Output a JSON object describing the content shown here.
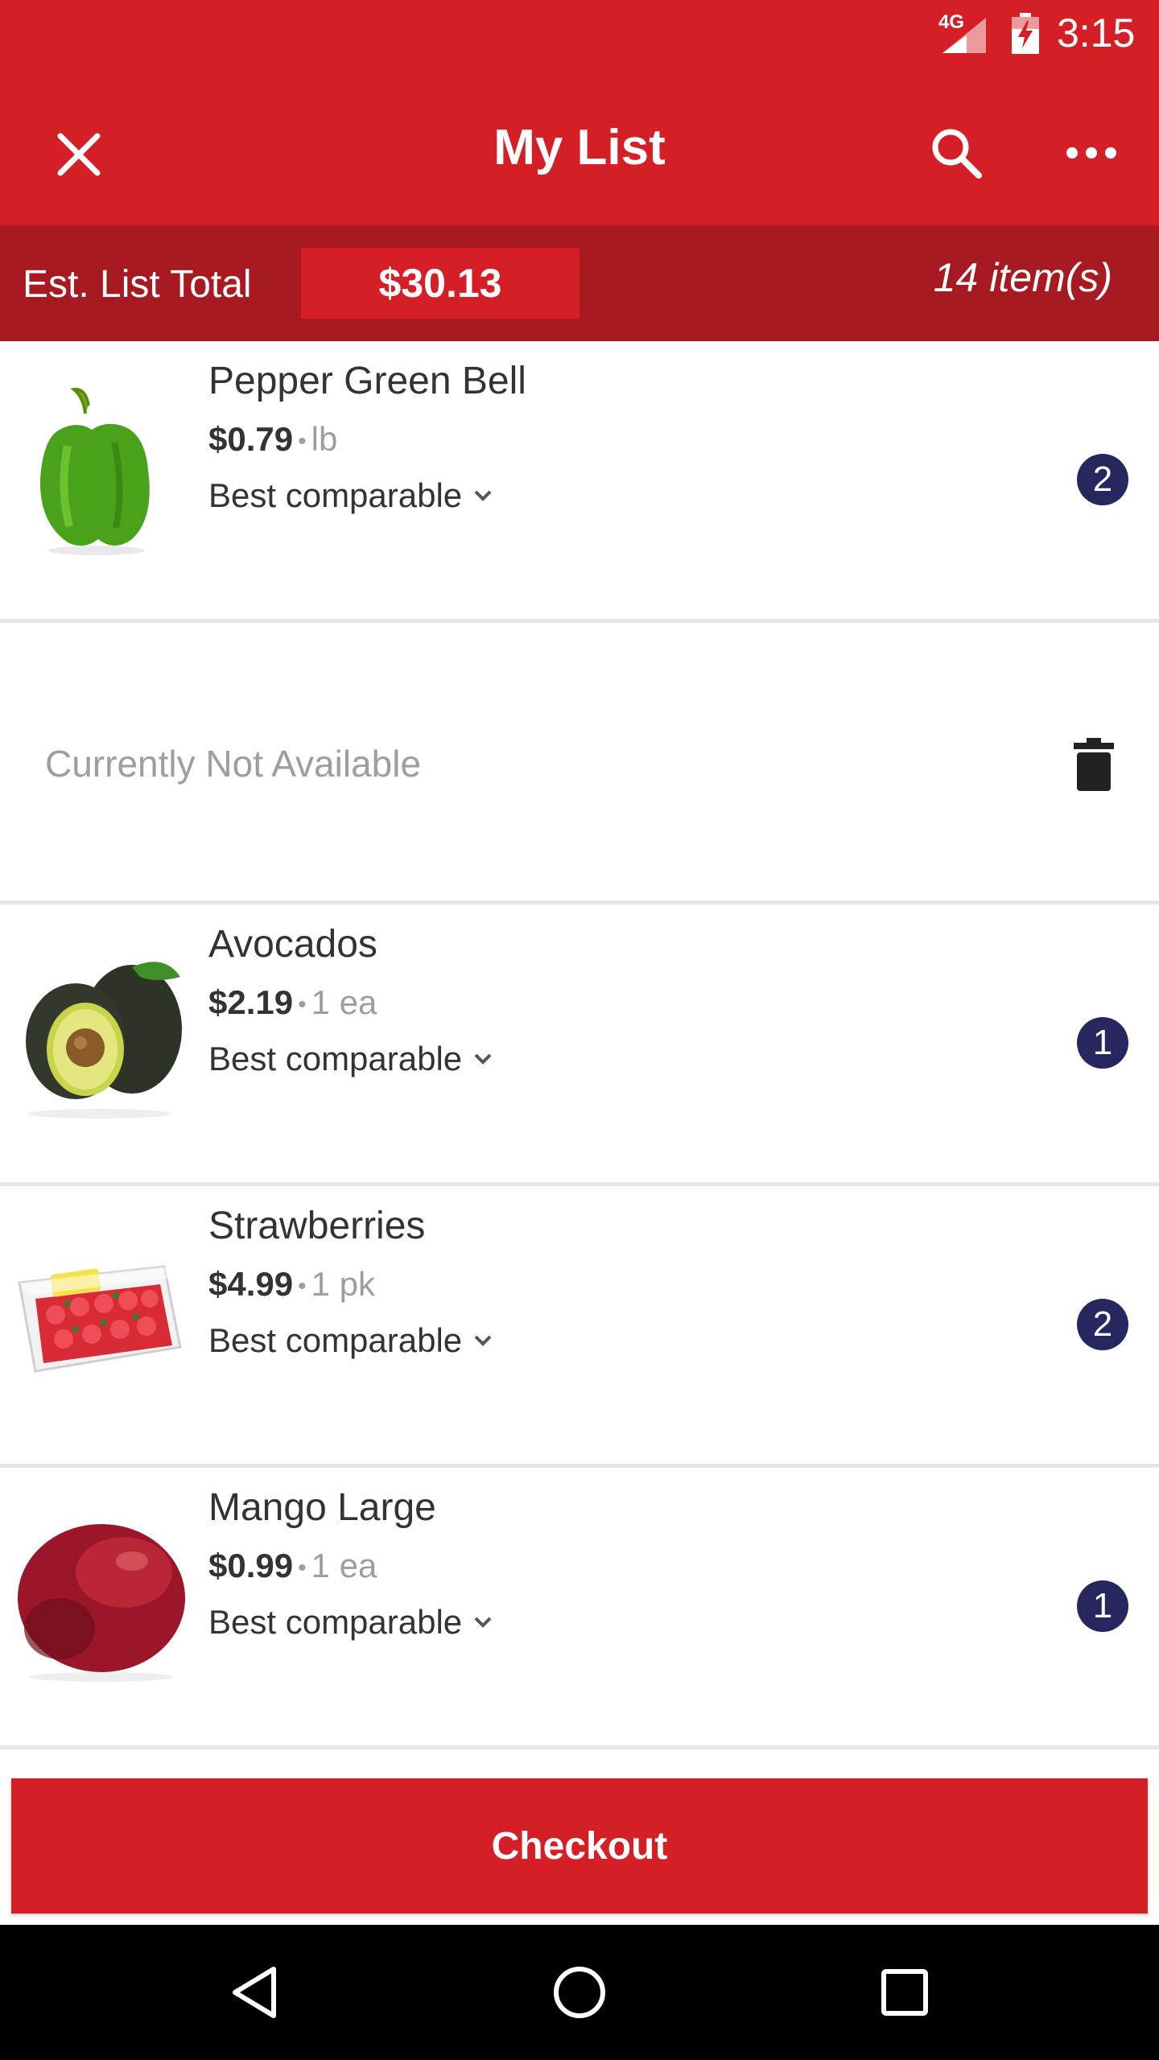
{
  "status_bar": {
    "network": "4G",
    "time": "3:15",
    "icons": [
      "signal-icon",
      "battery-charging-icon"
    ]
  },
  "toolbar": {
    "title": "My List",
    "close_icon": "close-icon",
    "search_icon": "search-icon",
    "more_icon": "more-horizontal-icon"
  },
  "summary": {
    "total_label": "Est. List Total",
    "total_value": "$30.13",
    "item_count": "14 item(s)"
  },
  "items": [
    {
      "name": "Pepper Green Bell",
      "price": "$0.79",
      "unit": "lb",
      "substitution": "Best comparable",
      "qty": "2",
      "image": "green-bell-pepper-image"
    },
    {
      "name": "Avocados",
      "price": "$2.19",
      "unit": "1 ea",
      "substitution": "Best comparable",
      "qty": "1",
      "image": "avocado-image"
    },
    {
      "name": "Strawberries",
      "price": "$4.99",
      "unit": "1 pk",
      "substitution": "Best comparable",
      "qty": "2",
      "image": "strawberries-image"
    },
    {
      "name": "Mango Large",
      "price": "$0.99",
      "unit": "1 ea",
      "substitution": "Best comparable",
      "qty": "1",
      "image": "mango-image"
    }
  ],
  "unavailable": {
    "label": "Currently Not Available",
    "icon": "trash-icon"
  },
  "checkout": {
    "label": "Checkout"
  },
  "nav_bar": {
    "icons": [
      "back-icon",
      "home-icon",
      "recents-icon"
    ]
  },
  "colors": {
    "brand_red": "#d41f26",
    "dark_red": "#a71a21",
    "qty_badge": "#27275f",
    "muted_text": "#9e9e9e"
  }
}
